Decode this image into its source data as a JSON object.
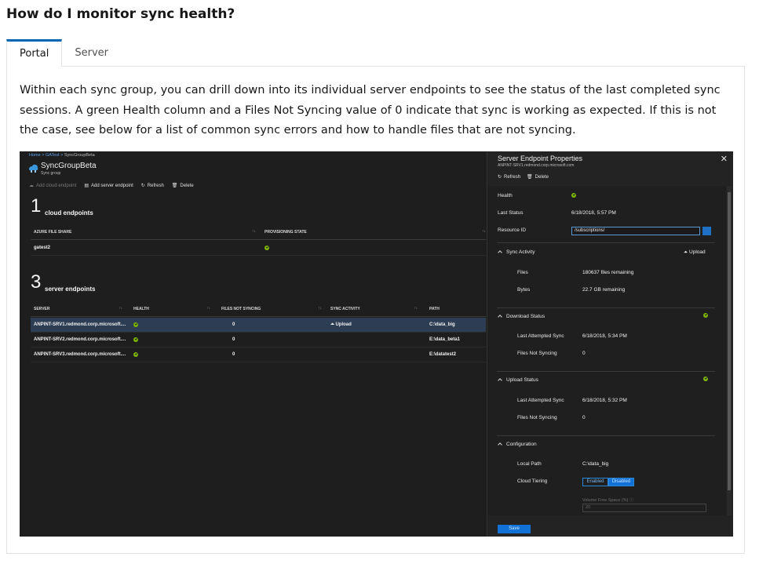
{
  "heading": "How do I monitor sync health?",
  "tabs": [
    {
      "label": "Portal",
      "active": true
    },
    {
      "label": "Server",
      "active": false
    }
  ],
  "paragraph": "Within each sync group, you can drill down into its individual server endpoints to see the status of the last completed sync sessions. A green Health column and a Files Not Syncing value of 0 indicate that sync is working as expected. If this is not the case, see below for a list of common sync errors and how to handle files that are not syncing.",
  "screenshot": {
    "breadcrumb": {
      "home": "Home",
      "gatest": "GATest",
      "current": "SyncGroupBeta",
      "sep": ">"
    },
    "title": "SyncGroupBeta",
    "subtitle": "Sync group",
    "toolbar": {
      "add_cloud": "Add cloud endpoint",
      "add_server": "Add server endpoint",
      "refresh": "Refresh",
      "delete": "Delete"
    },
    "cloud": {
      "count": "1",
      "label": "cloud endpoints",
      "headers": {
        "share": "AZURE FILE SHARE",
        "state": "PROVISIONING STATE"
      },
      "rows": [
        {
          "share": "gatest2"
        }
      ]
    },
    "server": {
      "count": "3",
      "label": "server endpoints",
      "headers": {
        "server": "SERVER",
        "health": "HEALTH",
        "files": "FILES NOT SYNCING",
        "activity": "SYNC ACTIVITY",
        "path": "PATH"
      },
      "rows": [
        {
          "server": "ANPINT-SRV1.redmond.corp.microsoft....",
          "files": "0",
          "activity": "Upload",
          "path": "C:\\data_big"
        },
        {
          "server": "ANPINT-SRV2.redmond.corp.microsoft....",
          "files": "0",
          "activity": "",
          "path": "E:\\data_beta1"
        },
        {
          "server": "ANPINT-SRV3.redmond.corp.microsoft....",
          "files": "0",
          "activity": "",
          "path": "E:\\datatest2"
        }
      ]
    },
    "props": {
      "title": "Server Endpoint Properties",
      "subtitle": "ANPINT-SRV1.redmond.corp.microsoft.com",
      "close": "✕",
      "refresh": "Refresh",
      "delete": "Delete",
      "health_label": "Health",
      "last_status_label": "Last Status",
      "last_status": "6/18/2018, 5:57 PM",
      "resource_id_label": "Resource ID",
      "resource_id": "/subscriptions/",
      "sync_activity": "Sync Activity",
      "sync_activity_value": "Upload",
      "files_label": "Files",
      "files_value": "180637 files remaining",
      "bytes_label": "Bytes",
      "bytes_value": "22.7 GB remaining",
      "download_status": "Download Status",
      "download_last_label": "Last Attempted Sync",
      "download_last": "6/18/2018, 5:34 PM",
      "download_fns_label": "Files Not Syncing",
      "download_fns": "0",
      "upload_status": "Upload Status",
      "upload_last_label": "Last Attempted Sync",
      "upload_last": "6/18/2018, 5:32 PM",
      "upload_fns_label": "Files Not Syncing",
      "upload_fns": "0",
      "configuration": "Configuration",
      "local_path_label": "Local Path",
      "local_path": "C:\\data_big",
      "cloud_tiering_label": "Cloud Tiering",
      "enabled": "Enabled",
      "disabled": "Disabled",
      "vfs_label": "Volume Free Space (%)",
      "vfs_value": "20",
      "save": "Save"
    },
    "colors": {
      "health": "#7fba00",
      "accent": "#1171d6"
    }
  }
}
